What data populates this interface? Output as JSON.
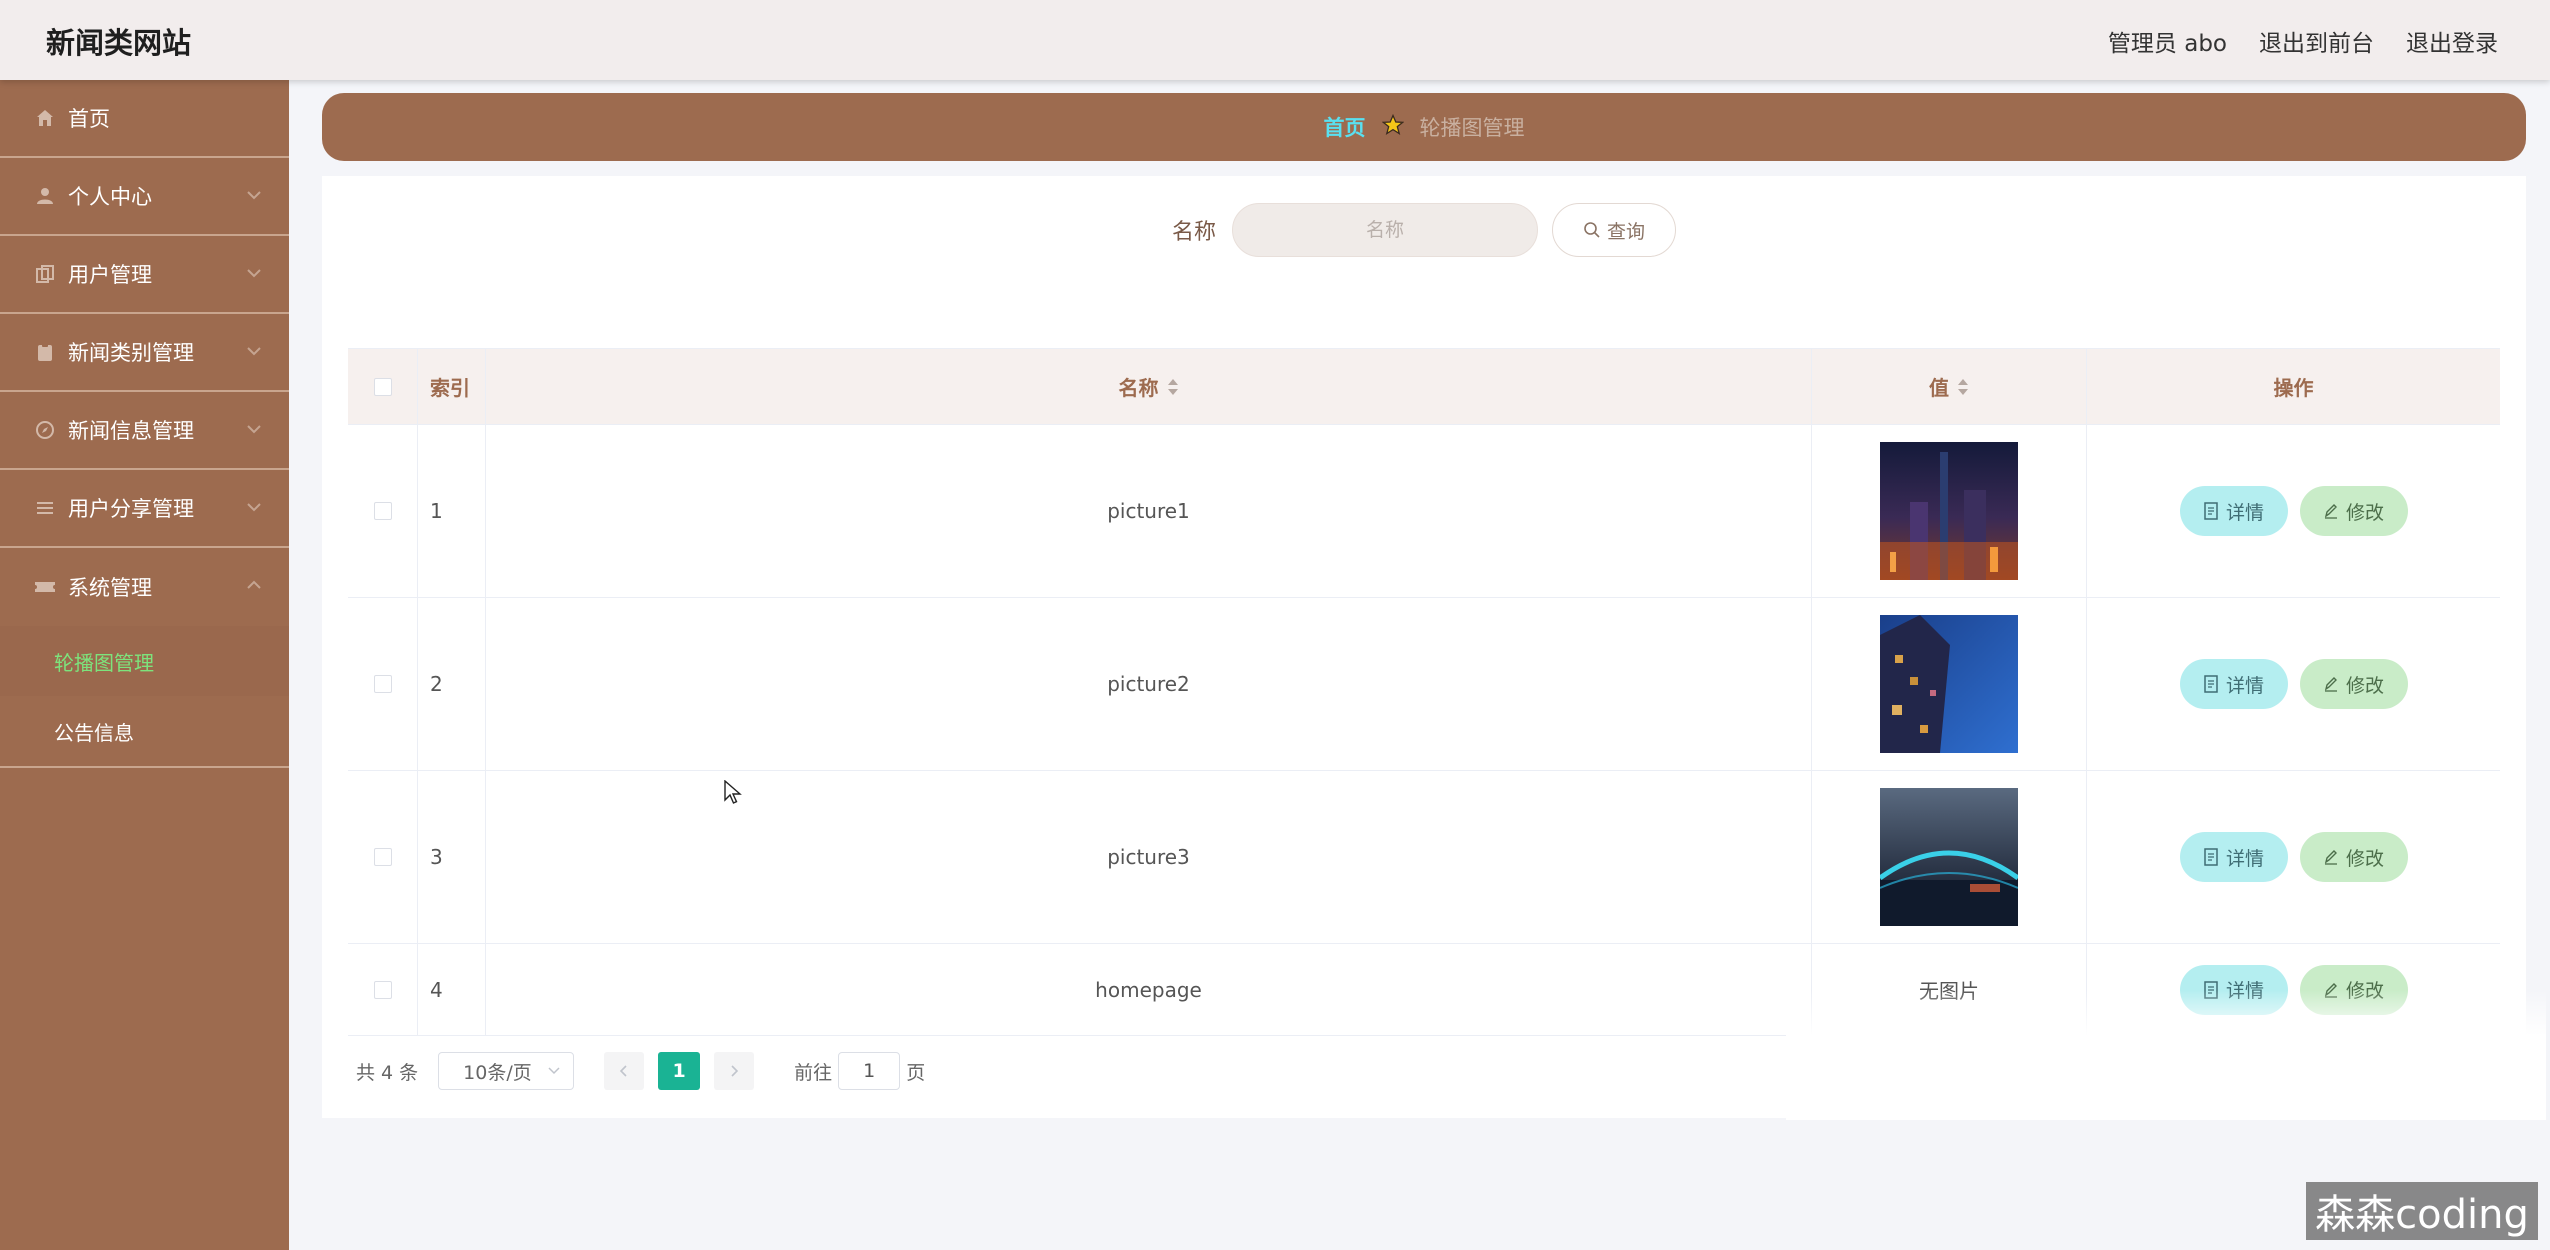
{
  "app": {
    "title": "新闻类网站"
  },
  "header": {
    "user_label": "管理员 abo",
    "to_front_label": "退出到前台",
    "logout_label": "退出登录"
  },
  "sidebar": {
    "items": [
      {
        "label": "首页",
        "icon": "home-icon"
      },
      {
        "label": "个人中心",
        "icon": "user-icon"
      },
      {
        "label": "用户管理",
        "icon": "copy-icon"
      },
      {
        "label": "新闻类别管理",
        "icon": "clipboard-icon"
      },
      {
        "label": "新闻信息管理",
        "icon": "compass-icon"
      },
      {
        "label": "用户分享管理",
        "icon": "list-icon"
      },
      {
        "label": "系统管理",
        "icon": "ticket-icon"
      }
    ],
    "sub_items": [
      {
        "label": "轮播图管理",
        "active": true
      },
      {
        "label": "公告信息",
        "active": false
      }
    ]
  },
  "breadcrumb": {
    "home": "首页",
    "current": "轮播图管理"
  },
  "search": {
    "label": "名称",
    "placeholder": "名称",
    "button_label": "查询"
  },
  "table": {
    "headers": {
      "index": "索引",
      "name": "名称",
      "value": "值",
      "ops": "操作"
    },
    "rows": [
      {
        "index": "1",
        "name": "picture1",
        "value": "image",
        "no_image_text": ""
      },
      {
        "index": "2",
        "name": "picture2",
        "value": "image",
        "no_image_text": ""
      },
      {
        "index": "3",
        "name": "picture3",
        "value": "image",
        "no_image_text": ""
      },
      {
        "index": "4",
        "name": "homepage",
        "value": "none",
        "no_image_text": "无图片"
      }
    ],
    "detail_label": "详情",
    "edit_label": "修改"
  },
  "pagination": {
    "total": "共 4 条",
    "page_size": "10条/页",
    "current_page": "1",
    "goto_prefix": "前往",
    "goto_value": "1",
    "goto_suffix": "页"
  },
  "watermark": "森森coding",
  "colors": {
    "sidebar_bg": "#9d6b4f",
    "header_bg": "#f2eded",
    "accent_active": "#7de37c",
    "breadcrumb_home": "#59e0f0",
    "pager_active": "#1ab394",
    "detail_btn": "#b4eef0",
    "edit_btn": "#c9ecc8"
  }
}
